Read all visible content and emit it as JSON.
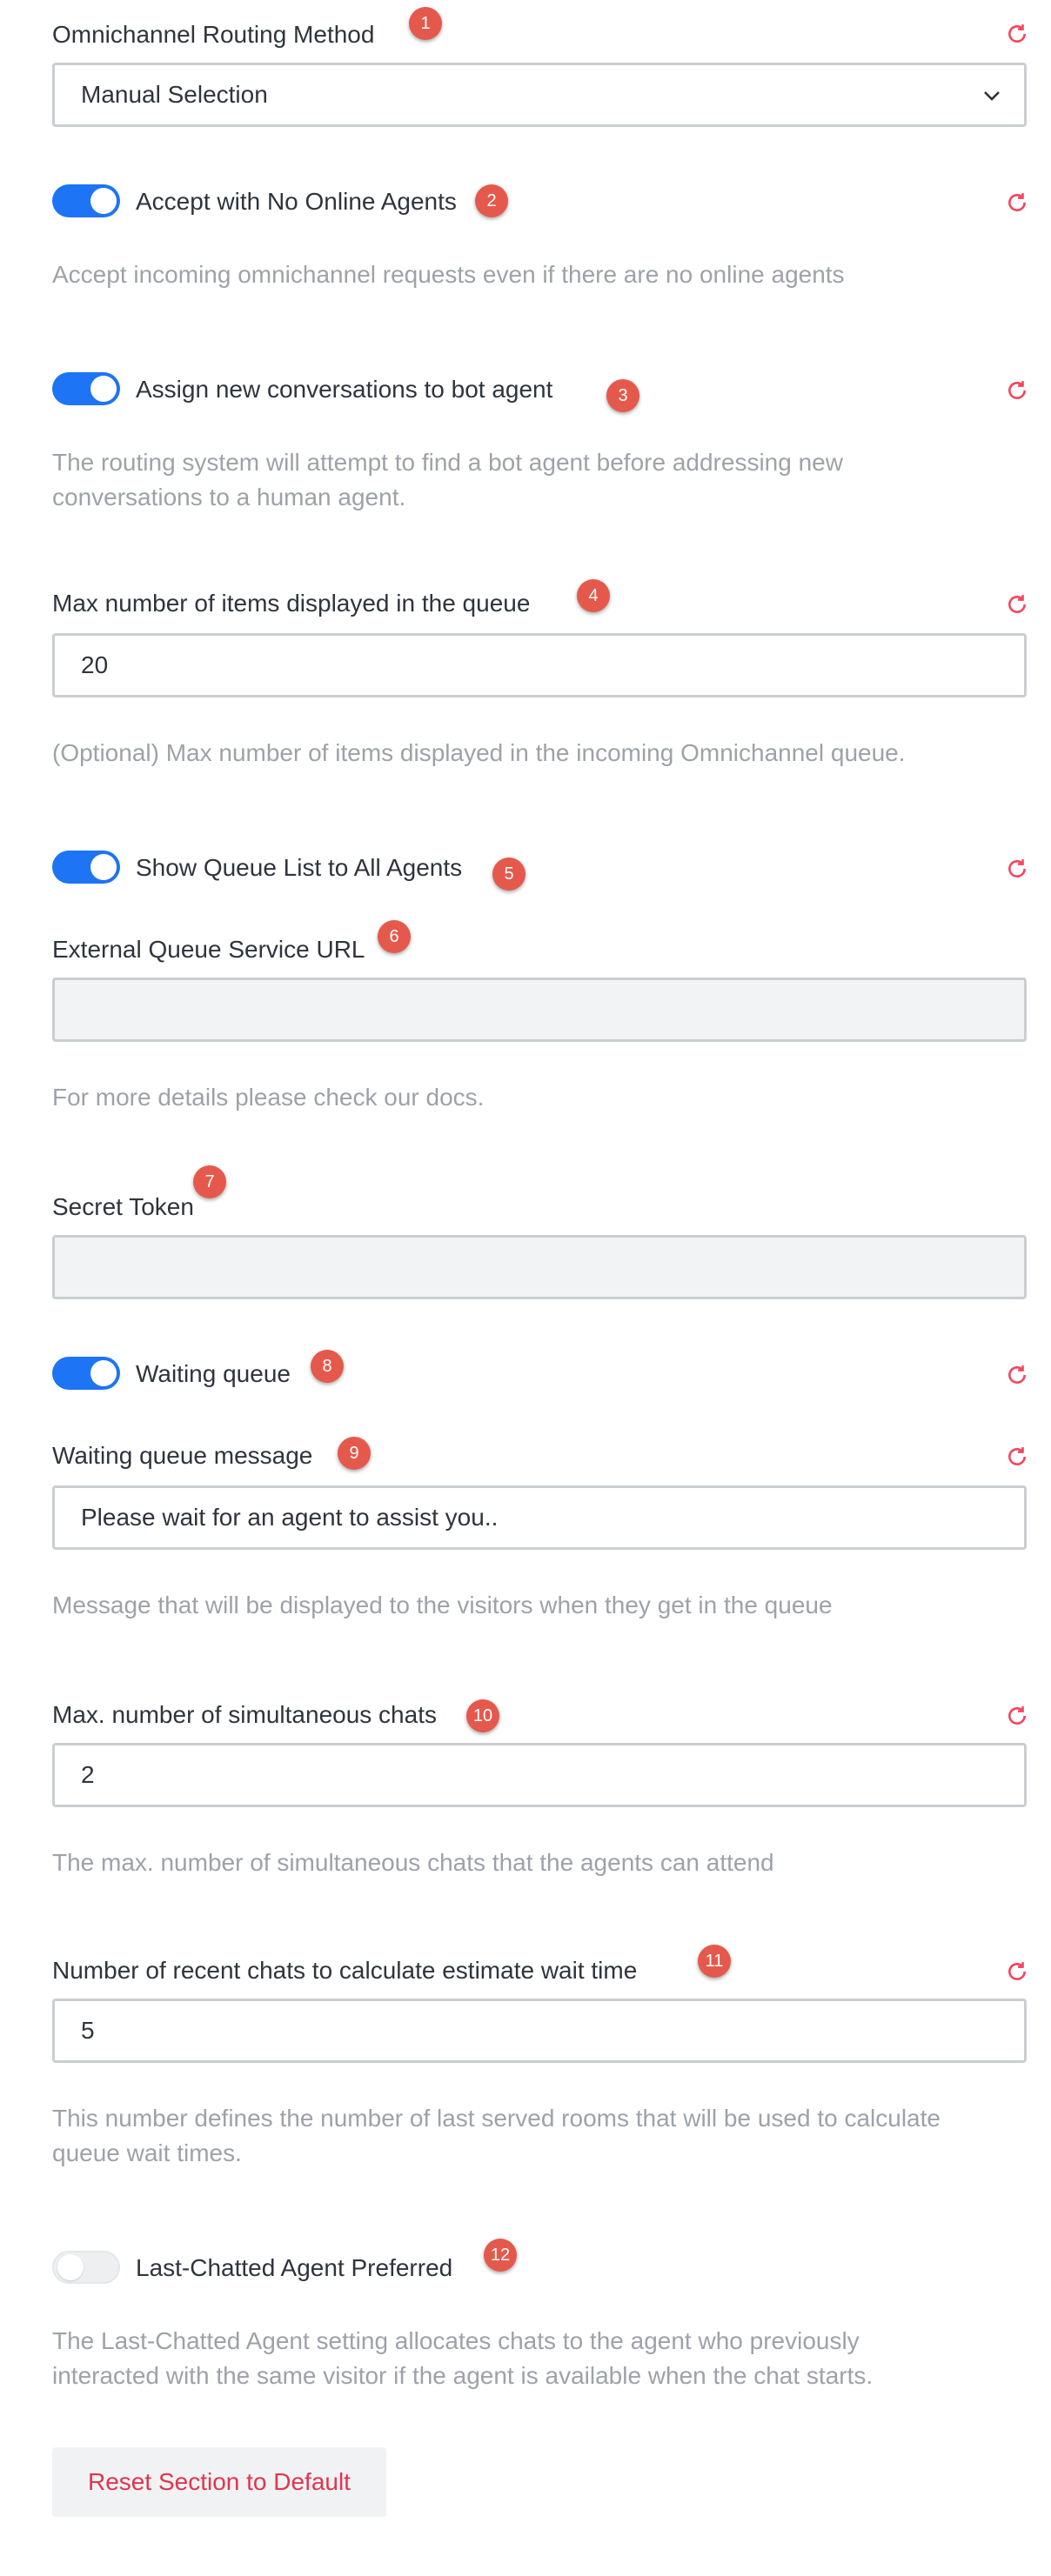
{
  "fields": {
    "routing_method": {
      "label": "Omnichannel Routing Method",
      "value": "Manual Selection"
    },
    "accept_no_agents": {
      "label": "Accept with No Online Agents",
      "description": "Accept incoming omnichannel requests even if there are no online agents",
      "enabled": true
    },
    "assign_bot": {
      "label": "Assign new conversations to bot agent",
      "description_line1": "The routing system will attempt to find a bot agent before addressing new",
      "description_line2": "conversations to a human agent.",
      "enabled": true
    },
    "max_queue_items": {
      "label": "Max number of items displayed in the queue",
      "value": "20",
      "description": "(Optional) Max number of items displayed in the incoming Omnichannel queue."
    },
    "show_queue_list": {
      "label": "Show Queue List to All Agents",
      "enabled": true
    },
    "external_queue_url": {
      "label": "External Queue Service URL",
      "value": "",
      "description": "For more details please check our docs."
    },
    "secret_token": {
      "label": "Secret Token",
      "value": ""
    },
    "waiting_queue": {
      "label": "Waiting queue",
      "enabled": true
    },
    "waiting_queue_message": {
      "label": "Waiting queue message",
      "value": "Please wait for an agent to assist you..",
      "description": "Message that will be displayed to the visitors when they get in the queue"
    },
    "max_simultaneous_chats": {
      "label": "Max. number of simultaneous chats",
      "value": "2",
      "description": "The max. number of simultaneous chats that the agents can attend"
    },
    "recent_chats_wait_time": {
      "label": "Number of recent chats to calculate estimate wait time",
      "value": "5",
      "description_line1": "This number defines the number of last served rooms that will be used to calculate",
      "description_line2": "queue wait times."
    },
    "last_chatted_agent": {
      "label": "Last-Chatted Agent Preferred",
      "enabled": false,
      "description_line1": "The Last-Chatted Agent setting allocates chats to the agent who previously",
      "description_line2": "interacted with the same visitor if the agent is available when the chat starts."
    }
  },
  "badges": [
    "1",
    "2",
    "3",
    "4",
    "5",
    "6",
    "7",
    "8",
    "9",
    "10",
    "11",
    "12"
  ],
  "reset_section_label": "Reset Section to Default",
  "colors": {
    "accent": "#1d74f5",
    "badge": "#e5594d",
    "danger": "#e0364d",
    "muted": "#9ea2a8"
  },
  "icons": {
    "reset": "reset-icon",
    "dropdown": "chevron-down-icon"
  }
}
